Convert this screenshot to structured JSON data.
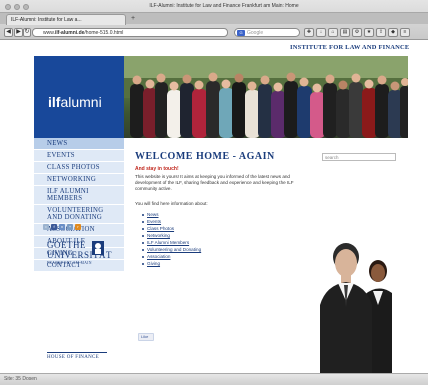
{
  "window": {
    "title": "ILF-Alumni: Institute for Law and Finance Frankfurt am Main: Home",
    "tab_label": "ILF-Alumni: Institute for Law a...",
    "url_prefix": "www.",
    "url_domain": "ilf-alumni.de",
    "url_path": "/home-515.0.html",
    "search_placeholder": "Google",
    "status_text": "Site: 35 Dosen"
  },
  "header": {
    "top_link": "INSTITUTE FOR LAW AND FINANCE",
    "logo_prefix": "ilf",
    "logo_suffix": "alumni"
  },
  "nav": {
    "items": [
      {
        "label": "NEWS",
        "active": true
      },
      {
        "label": "EVENTS"
      },
      {
        "label": "CLASS PHOTOS"
      },
      {
        "label": "NETWORKING"
      },
      {
        "label": "ILF ALUMNI",
        "label2": "MEMBERS"
      },
      {
        "label": "VOLUNTEERING",
        "label2": "AND DONATING"
      },
      {
        "label": "ASSOCIATION"
      },
      {
        "label": "ABOUT ILF"
      },
      {
        "label": "GIVING"
      },
      {
        "label": "CONTACT"
      }
    ]
  },
  "main": {
    "title": "WELCOME HOME - AGAIN",
    "lead": "And stay in touch!",
    "paragraph": "This website is yours! It aims at keeping you informed of the latest news and development of the ILF, sharing feedback and experience and keeping the ILF community active.",
    "find_text": "You will find here information about:",
    "links": [
      "News",
      "Events",
      "Class Photos",
      "Networking",
      "ILF Alumni Members",
      "Volunteering and Donating",
      "Association",
      "Giving"
    ],
    "like_label": "Like"
  },
  "sidebar": {
    "search_placeholder": "search",
    "goethe_line1": "GOETHE",
    "goethe_line2": "UNIVERSITÄT",
    "goethe_sub": "FRANKFURT AM MAIN",
    "hof_text": "HOUSE OF FINANCE"
  },
  "colors": {
    "brand_blue": "#18489a",
    "nav_bg": "#dfe9f6",
    "accent_red": "#c0261c"
  }
}
